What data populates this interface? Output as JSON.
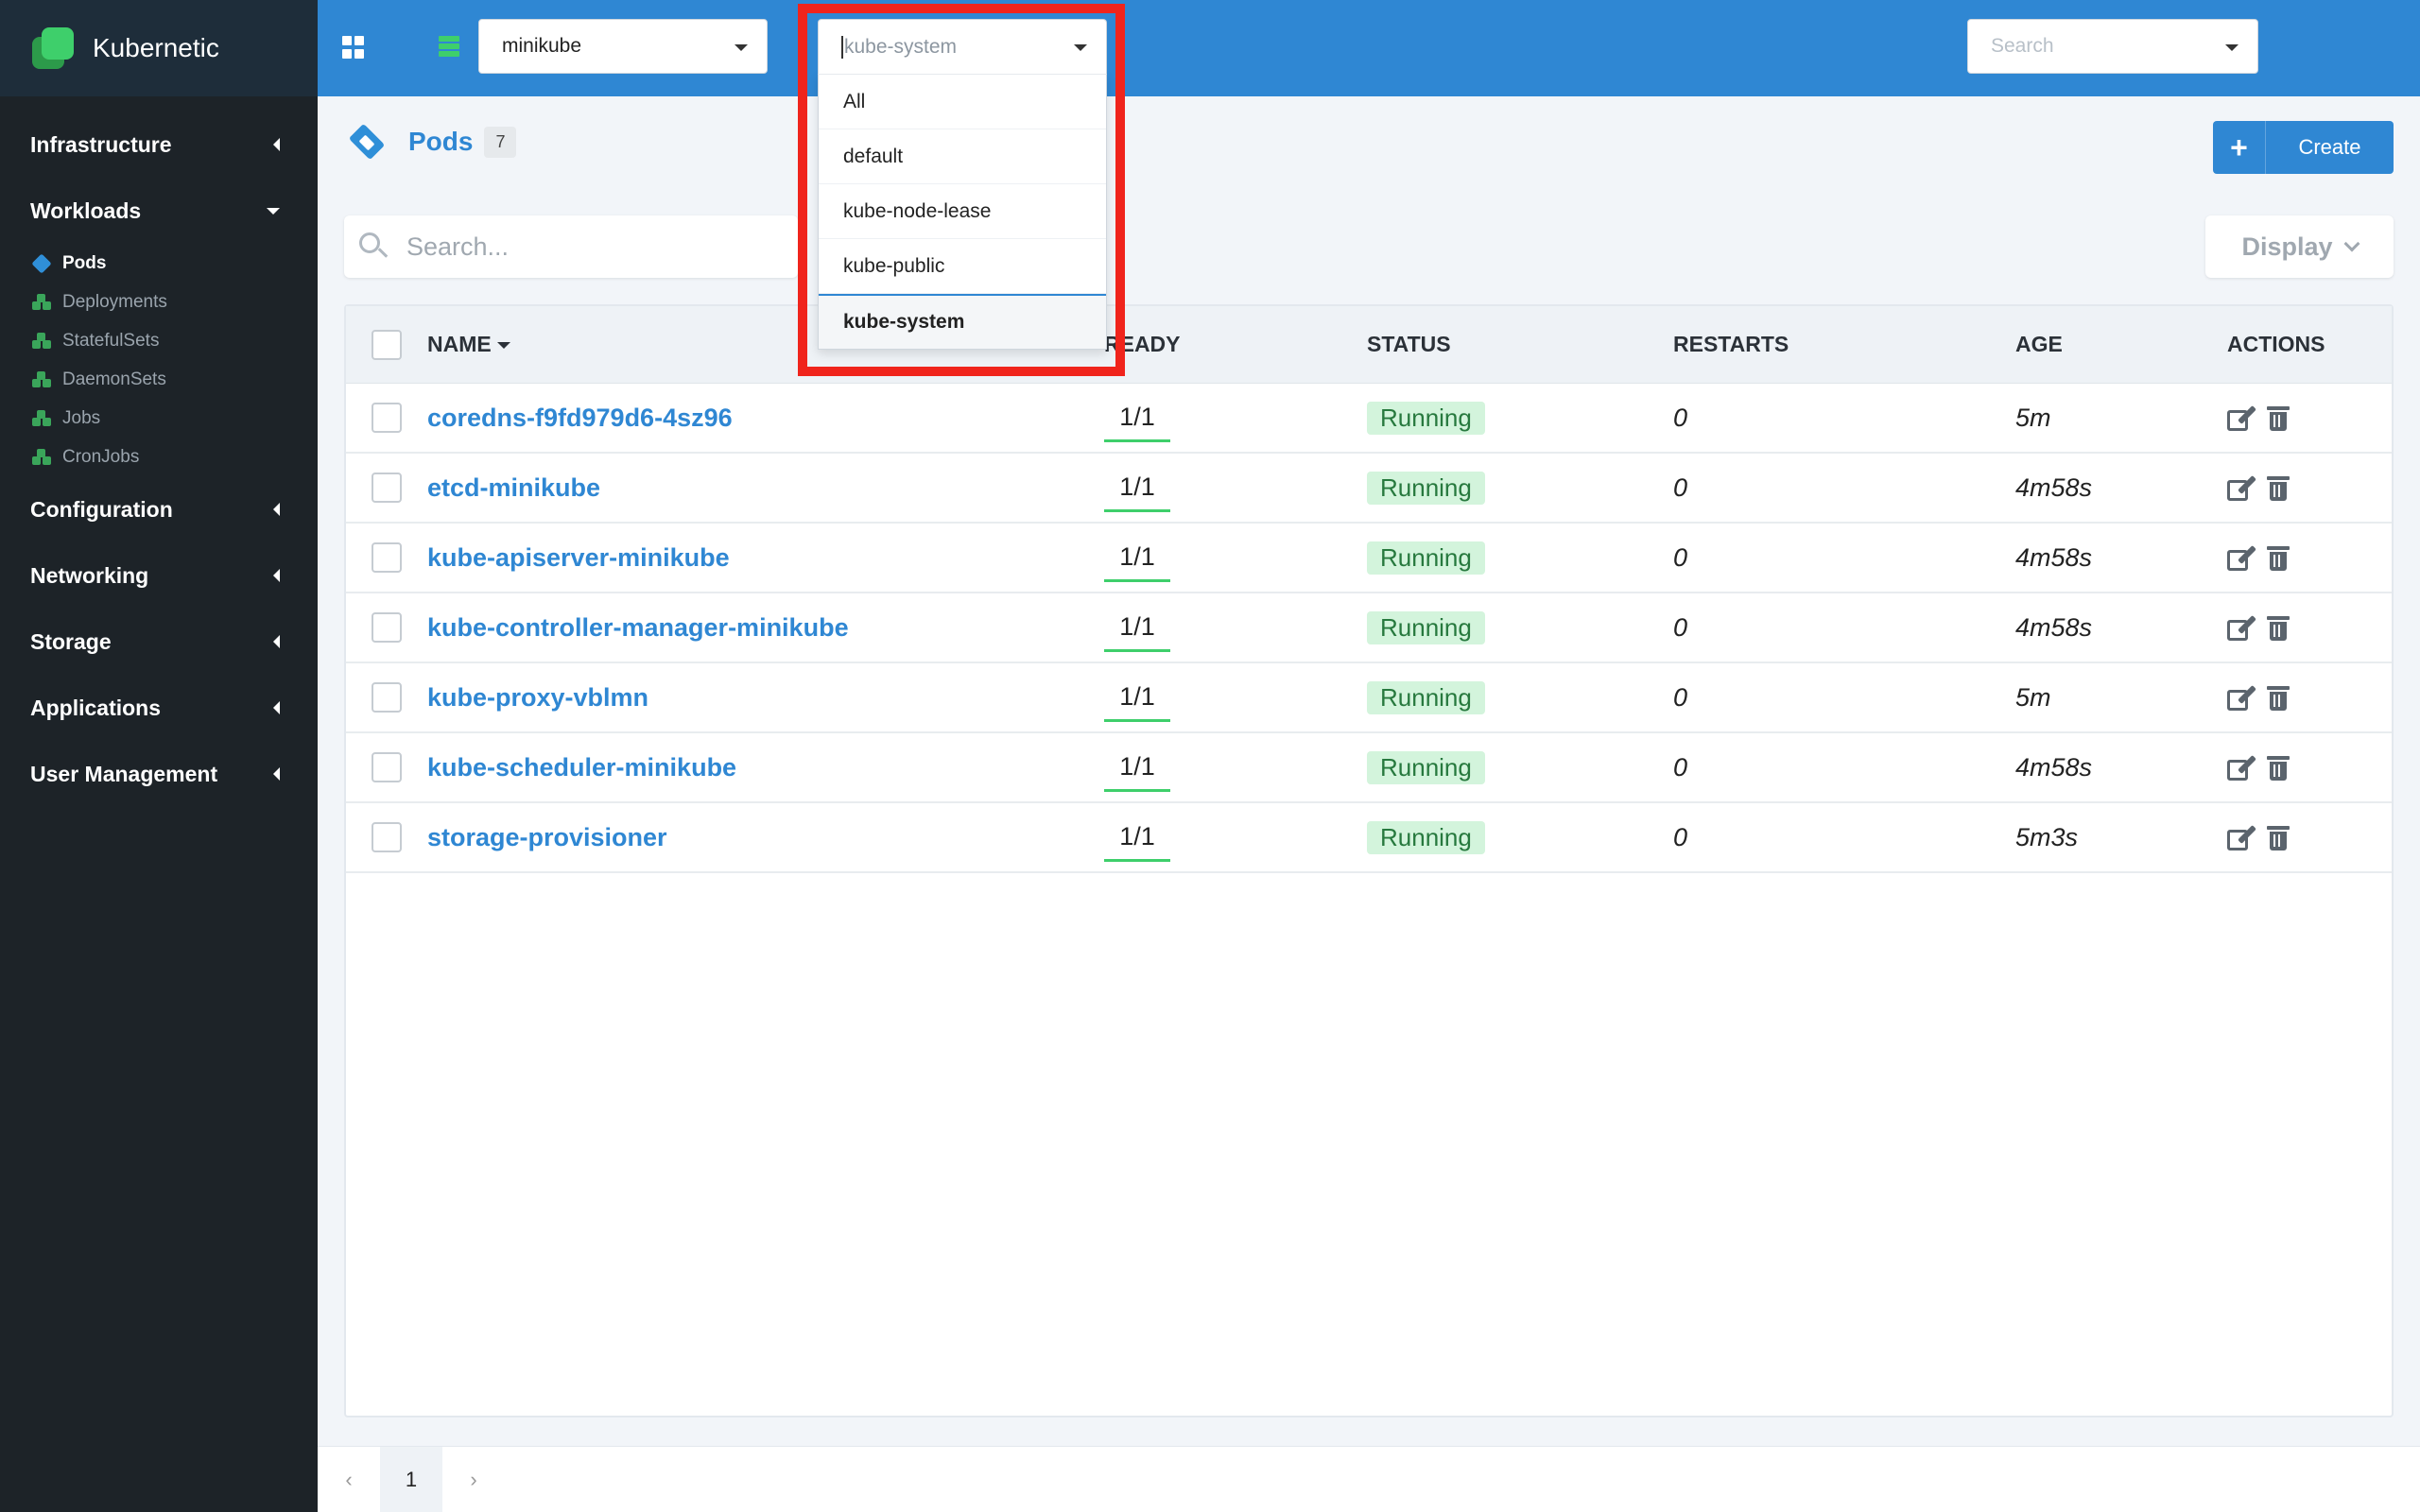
{
  "brand": {
    "name": "Kubernetic"
  },
  "sidebar": {
    "groups": [
      {
        "label": "Infrastructure"
      },
      {
        "label": "Workloads"
      },
      {
        "label": "Configuration"
      },
      {
        "label": "Networking"
      },
      {
        "label": "Storage"
      },
      {
        "label": "Applications"
      },
      {
        "label": "User Management"
      }
    ],
    "workloads_items": [
      {
        "label": "Pods"
      },
      {
        "label": "Deployments"
      },
      {
        "label": "StatefulSets"
      },
      {
        "label": "DaemonSets"
      },
      {
        "label": "Jobs"
      },
      {
        "label": "CronJobs"
      }
    ]
  },
  "topbar": {
    "cluster": "minikube",
    "namespace_value": "kube-system",
    "search_placeholder": "Search"
  },
  "namespace_menu": {
    "options": [
      "All",
      "default",
      "kube-node-lease",
      "kube-public",
      "kube-system"
    ],
    "selected": "kube-system"
  },
  "page": {
    "title": "Pods",
    "count": "7",
    "create_label": "Create",
    "search_placeholder": "Search...",
    "display_label": "Display"
  },
  "table": {
    "headers": {
      "name": "NAME",
      "ready": "READY",
      "status": "STATUS",
      "restarts": "RESTARTS",
      "age": "AGE",
      "actions": "ACTIONS"
    },
    "rows": [
      {
        "name": "coredns-f9fd979d6-4sz96",
        "ready": "1/1",
        "status": "Running",
        "restarts": "0",
        "age": "5m"
      },
      {
        "name": "etcd-minikube",
        "ready": "1/1",
        "status": "Running",
        "restarts": "0",
        "age": "4m58s"
      },
      {
        "name": "kube-apiserver-minikube",
        "ready": "1/1",
        "status": "Running",
        "restarts": "0",
        "age": "4m58s"
      },
      {
        "name": "kube-controller-manager-minikube",
        "ready": "1/1",
        "status": "Running",
        "restarts": "0",
        "age": "4m58s"
      },
      {
        "name": "kube-proxy-vblmn",
        "ready": "1/1",
        "status": "Running",
        "restarts": "0",
        "age": "5m"
      },
      {
        "name": "kube-scheduler-minikube",
        "ready": "1/1",
        "status": "Running",
        "restarts": "0",
        "age": "4m58s"
      },
      {
        "name": "storage-provisioner",
        "ready": "1/1",
        "status": "Running",
        "restarts": "0",
        "age": "5m3s"
      }
    ]
  },
  "pagination": {
    "prev": "‹",
    "current": "1",
    "next": "›"
  },
  "colors": {
    "accent": "#2f87d3",
    "sidebar": "#1d2328",
    "running_bg": "#d3f4dc",
    "highlight": "#f0241c"
  }
}
